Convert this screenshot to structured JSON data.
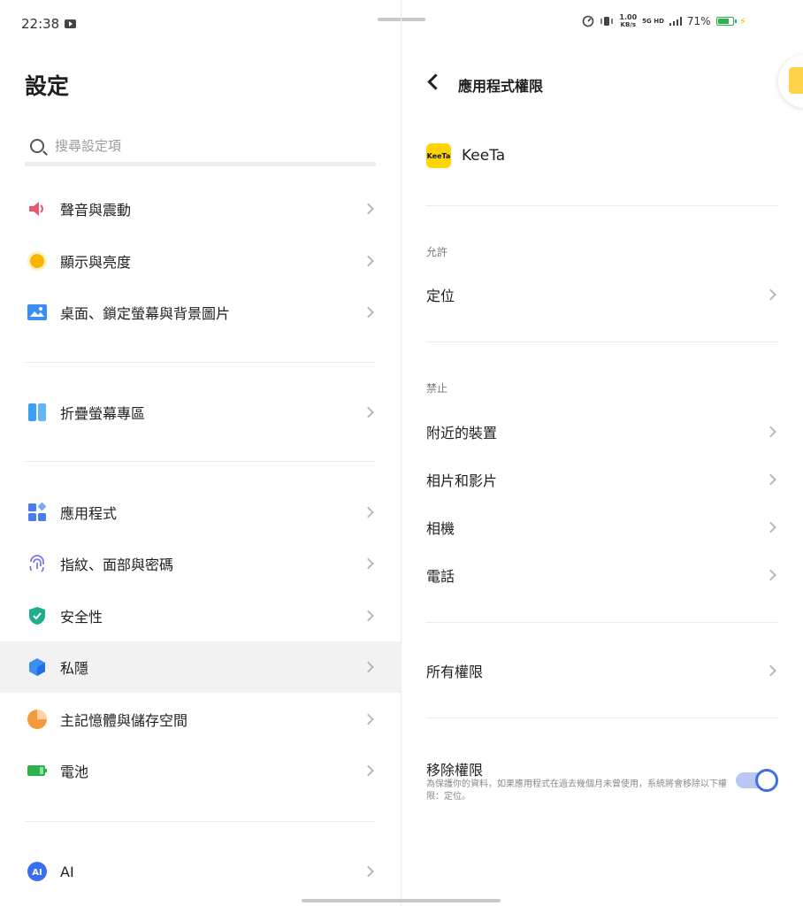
{
  "status": {
    "time": "22:38",
    "speed_top": "1.00",
    "speed_unit": "KB/s",
    "network": "5G HD",
    "battery": "71%"
  },
  "left": {
    "title": "設定",
    "search_placeholder": "搜尋設定項",
    "items": [
      {
        "label": "聲音與震動",
        "icon": "speaker-icon",
        "color": "#e85a6b"
      },
      {
        "label": "顯示與亮度",
        "icon": "brightness-icon",
        "color": "#f7b500"
      },
      {
        "label": "桌面、鎖定螢幕與背景圖片",
        "icon": "wallpaper-icon",
        "color": "#3a8ef6"
      },
      {
        "label": "折疊螢幕專區",
        "icon": "fold-screen-icon",
        "color": "#3a9ef6"
      },
      {
        "label": "應用程式",
        "icon": "apps-icon",
        "color": "#4a7cf0"
      },
      {
        "label": "指紋、面部與密碼",
        "icon": "fingerprint-icon",
        "color": "#6a6af0"
      },
      {
        "label": "安全性",
        "icon": "shield-icon",
        "color": "#1fae8c"
      },
      {
        "label": "私隱",
        "icon": "privacy-icon",
        "color": "#3a8ef6"
      },
      {
        "label": "主記憶體與儲存空間",
        "icon": "storage-icon",
        "color": "#f59a3a"
      },
      {
        "label": "電池",
        "icon": "battery-icon",
        "color": "#2bb24c"
      },
      {
        "label": "AI",
        "icon": "ai-icon",
        "color": "#3a6ef0"
      }
    ]
  },
  "right": {
    "title": "應用程式權限",
    "app_name": "KeeTa",
    "app_logo_text": "KeeTa",
    "allowed_header": "允許",
    "allowed": [
      {
        "label": "定位"
      }
    ],
    "denied_header": "禁止",
    "denied": [
      {
        "label": "附近的裝置"
      },
      {
        "label": "相片和影片"
      },
      {
        "label": "相機"
      },
      {
        "label": "電話"
      }
    ],
    "all_permissions": "所有權限",
    "remove_title": "移除權限",
    "remove_desc": "為保護你的資料，如果應用程式在過去幾個月未曾使用，系統將會移除以下權限：定位。",
    "remove_enabled": true
  }
}
